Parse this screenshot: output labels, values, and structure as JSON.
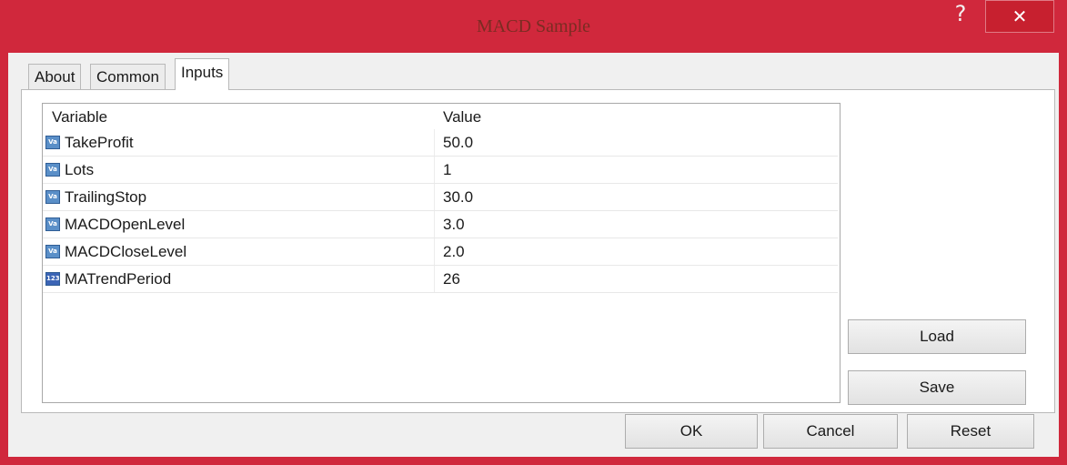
{
  "window": {
    "title": "MACD Sample",
    "help_glyph": "?",
    "close_glyph": "✕"
  },
  "tabs": [
    {
      "label": "About",
      "active": false
    },
    {
      "label": "Common",
      "active": false
    },
    {
      "label": "Inputs",
      "active": true
    }
  ],
  "inputs_table": {
    "columns": [
      "Variable",
      "Value"
    ],
    "rows": [
      {
        "variable": "TakeProfit",
        "value": "50.0",
        "type_icon": "double-var-icon",
        "icon_text": "Va"
      },
      {
        "variable": "Lots",
        "value": "1",
        "type_icon": "double-var-icon",
        "icon_text": "Va"
      },
      {
        "variable": "TrailingStop",
        "value": "30.0",
        "type_icon": "double-var-icon",
        "icon_text": "Va"
      },
      {
        "variable": "MACDOpenLevel",
        "value": "3.0",
        "type_icon": "double-var-icon",
        "icon_text": "Va"
      },
      {
        "variable": "MACDCloseLevel",
        "value": "2.0",
        "type_icon": "double-var-icon",
        "icon_text": "Va"
      },
      {
        "variable": "MATrendPeriod",
        "value": "26",
        "type_icon": "integer-var-icon",
        "icon_text": "123"
      }
    ]
  },
  "side_buttons": {
    "load": "Load",
    "save": "Save"
  },
  "footer_buttons": {
    "ok": "OK",
    "cancel": "Cancel",
    "reset": "Reset"
  },
  "colors": {
    "titlebar": "#d0283c",
    "client": "#f0f0f0"
  }
}
